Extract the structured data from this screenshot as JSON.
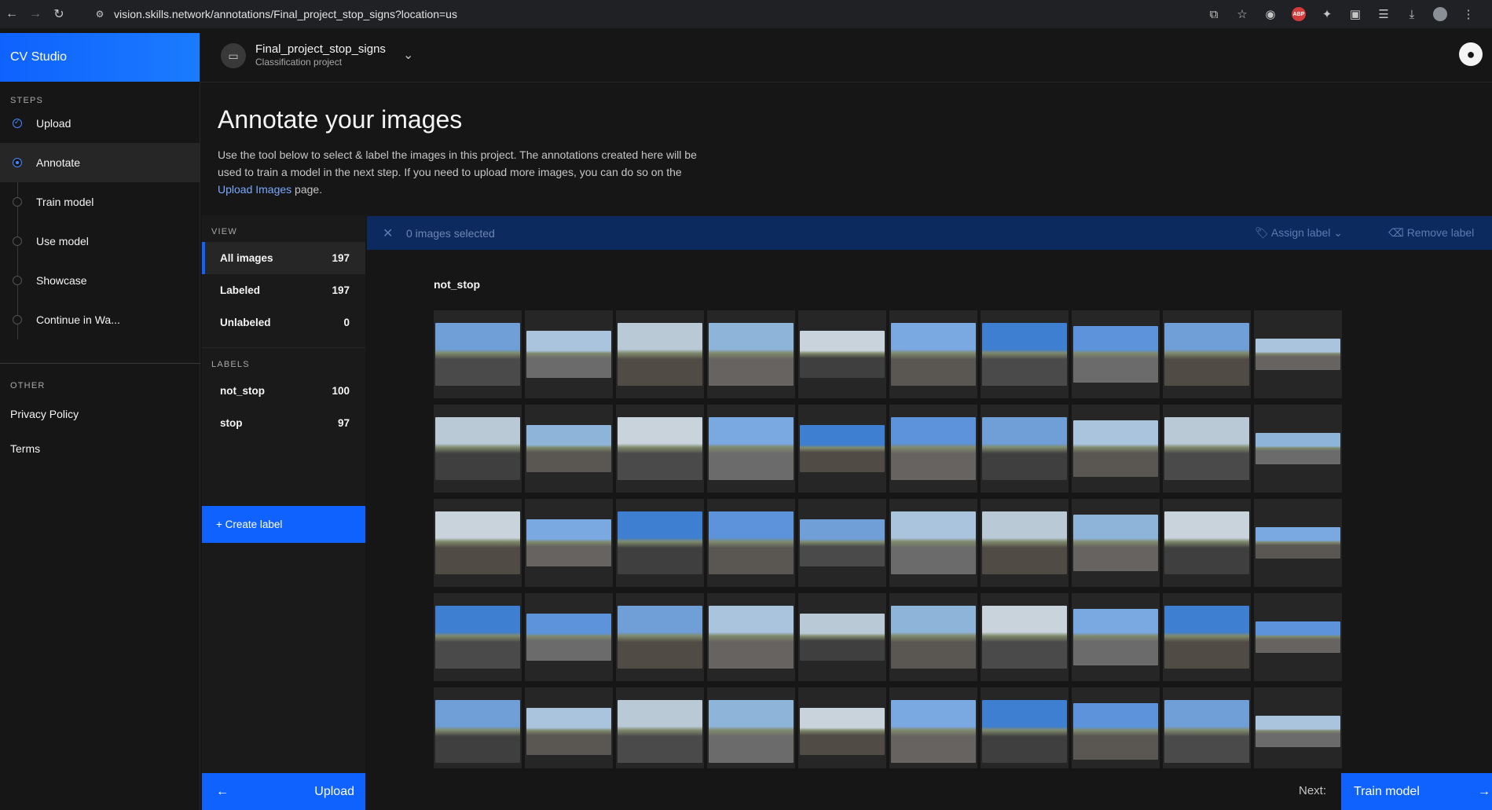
{
  "browser": {
    "url": "vision.skills.network/annotations/Final_project_stop_signs?location=us",
    "back_icon": "arrow-left-icon",
    "forward_icon": "arrow-right-icon",
    "reload_icon": "reload-icon"
  },
  "app": {
    "brand": "CV Studio",
    "project_name": "Final_project_stop_signs",
    "project_type": "Classification project"
  },
  "sidebar": {
    "steps_title": "STEPS",
    "steps": [
      {
        "label": "Upload",
        "state": "done"
      },
      {
        "label": "Annotate",
        "state": "current"
      },
      {
        "label": "Train model",
        "state": "todo"
      },
      {
        "label": "Use model",
        "state": "todo"
      },
      {
        "label": "Showcase",
        "state": "todo"
      },
      {
        "label": "Continue in Wa...",
        "state": "todo"
      }
    ],
    "other_title": "OTHER",
    "other_links": [
      "Privacy Policy",
      "Terms"
    ]
  },
  "main": {
    "title": "Annotate your images",
    "desc_prefix": "Use the tool below to select & label the images in this project. The annotations created here will be used to train a model in the next step. If you need to upload more images, you can do so on the ",
    "desc_link": "Upload Images",
    "desc_suffix": " page."
  },
  "filter": {
    "view_title": "VIEW",
    "views": [
      {
        "label": "All images",
        "count": "197"
      },
      {
        "label": "Labeled",
        "count": "197"
      },
      {
        "label": "Unlabeled",
        "count": "0"
      }
    ],
    "labels_title": "LABELS",
    "labels": [
      {
        "label": "not_stop",
        "count": "100"
      },
      {
        "label": "stop",
        "count": "97"
      }
    ],
    "create_label": "+ Create label"
  },
  "selection": {
    "text": "0 images selected",
    "assign": "Assign label",
    "remove": "Remove label"
  },
  "gallery": {
    "group": "not_stop",
    "rows": 5,
    "cols": 10
  },
  "footer": {
    "upload": "Upload",
    "next_label": "Next:",
    "train": "Train model"
  },
  "colors": {
    "accent": "#0f62fe",
    "selection_bar": "#0c2a5e"
  }
}
